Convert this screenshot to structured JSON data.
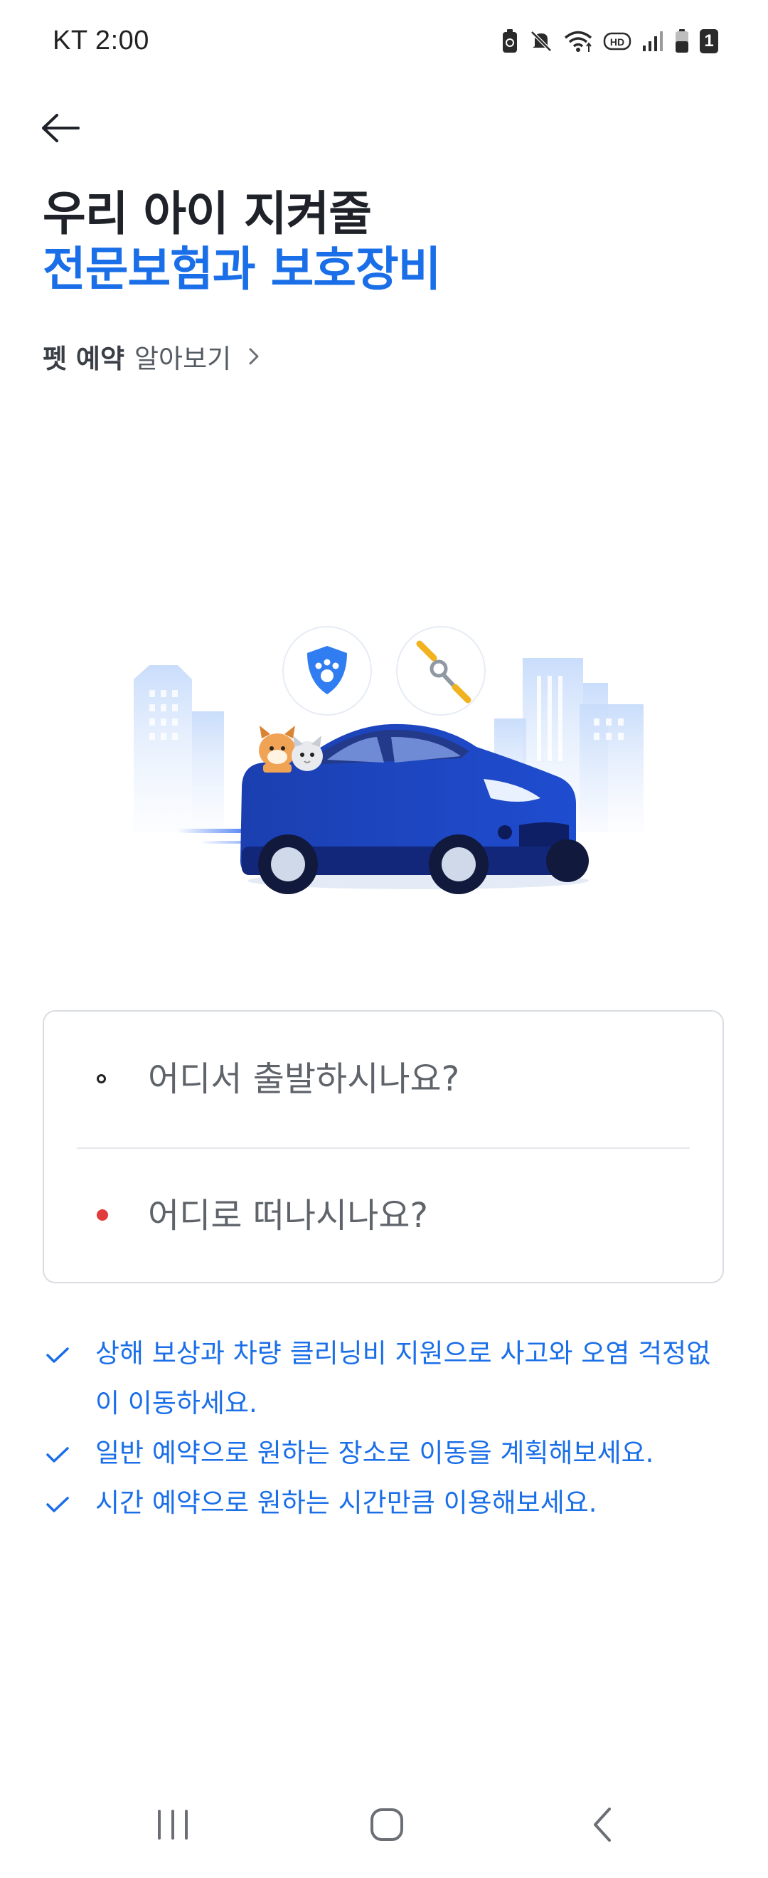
{
  "status_bar": {
    "carrier_time": "KT 2:00",
    "icons": [
      "battery-saver-icon",
      "mute-icon",
      "wifi-icon",
      "hd-icon",
      "signal-icon",
      "battery-icon",
      "sim-badge-icon"
    ],
    "sim_badge": "1"
  },
  "header": {
    "back_icon": "arrow-left-icon"
  },
  "hero": {
    "title_line1": "우리 아이 지켜줄",
    "title_line2": "전문보험과 보호장비",
    "learn_more_bold": "펫 예약",
    "learn_more_text": "알아보기",
    "title_color": "#1f2329",
    "accent_color": "#1a6fe8"
  },
  "illustration": {
    "icons": [
      "paw-shield-icon",
      "leash-icon",
      "car-icon",
      "dog-icon",
      "cat-icon"
    ]
  },
  "route": {
    "origin_placeholder": "어디서 출발하시나요?",
    "destination_placeholder": "어디로 떠나시나요?",
    "destination_dot_color": "#e23b3b"
  },
  "benefits": [
    "상해 보상과 차량 클리닝비 지원으로 사고와 오염 걱정없이 이동하세요.",
    "일반 예약으로 원하는 장소로 이동을 계획해보세요.",
    "시간 예약으로 원하는 시간만큼 이용해보세요."
  ],
  "nav_bar": {
    "icons": [
      "recents-icon",
      "home-icon",
      "back-icon"
    ]
  }
}
